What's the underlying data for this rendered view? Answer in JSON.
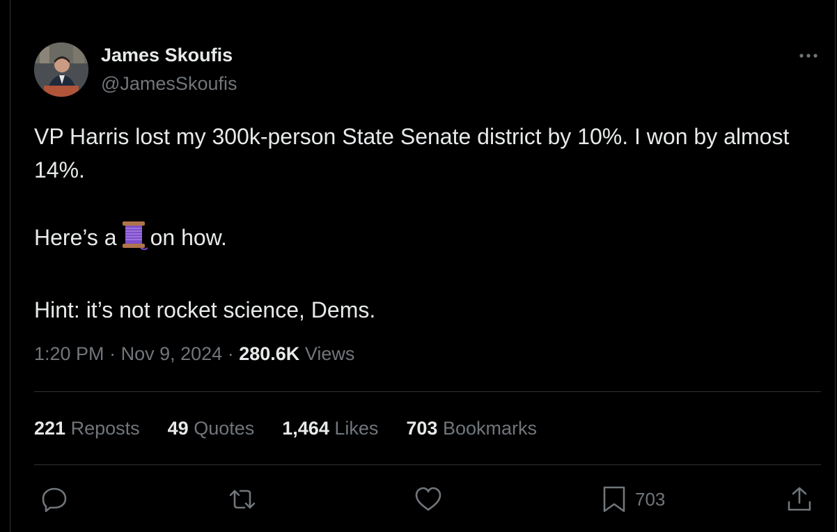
{
  "author": {
    "name": "James Skoufis",
    "handle": "@JamesSkoufis",
    "avatar_icon": "profile-photo"
  },
  "tweet": {
    "line1": "VP Harris lost my 300k-person State Senate district by 10%. I won by almost 14%.",
    "line2_prefix": "Here’s a",
    "line2_emoji": "thread-spool",
    "line2_suffix": "on how.",
    "line3": "Hint: it’s not rocket science, Dems."
  },
  "meta": {
    "time": "1:20 PM",
    "date": "Nov 9, 2024",
    "views_count": "280.6K",
    "views_label": "Views",
    "separator": "·"
  },
  "stats": [
    {
      "count": "221",
      "label": "Reposts"
    },
    {
      "count": "49",
      "label": "Quotes"
    },
    {
      "count": "1,464",
      "label": "Likes"
    },
    {
      "count": "703",
      "label": "Bookmarks"
    }
  ],
  "actions": {
    "reply_icon": "reply-icon",
    "repost_icon": "repost-icon",
    "like_icon": "heart-icon",
    "bookmark_icon": "bookmark-icon",
    "bookmark_count": "703",
    "share_icon": "share-icon",
    "more_icon": "more-icon"
  },
  "colors": {
    "background": "#000000",
    "text_primary": "#e7e9ea",
    "text_secondary": "#71767b",
    "divider": "#2f3336"
  }
}
